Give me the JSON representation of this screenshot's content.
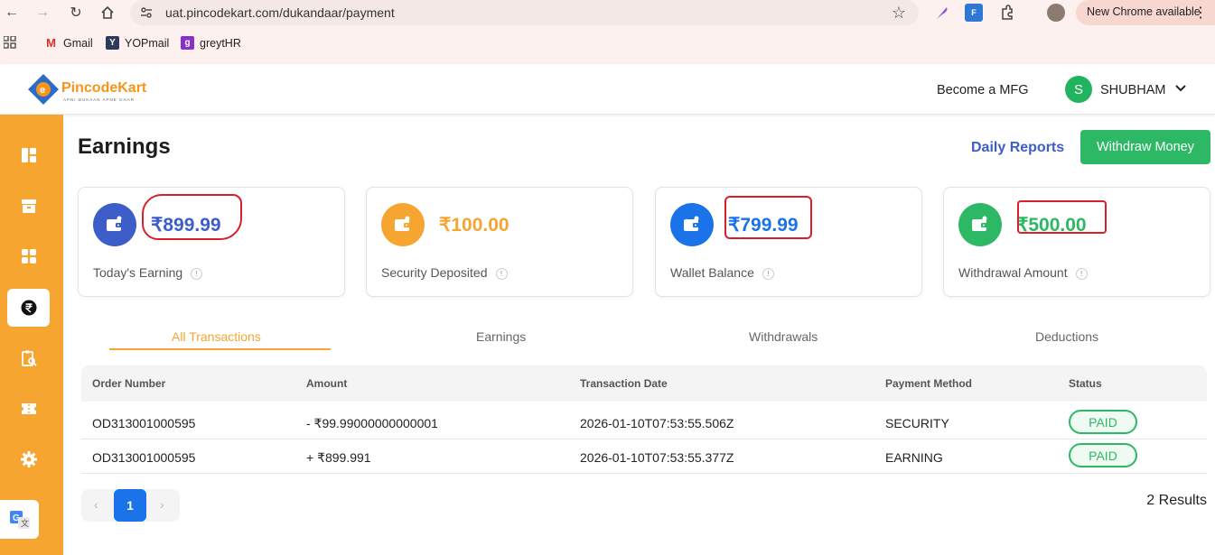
{
  "browser": {
    "url": "uat.pincodekart.com/dukandaar/payment",
    "new_chrome": "New Chrome available",
    "bookmarks": [
      {
        "label": "Gmail"
      },
      {
        "label": "YOPmail"
      },
      {
        "label": "greytHR"
      }
    ]
  },
  "header": {
    "logo_text": "PincodeKart",
    "logo_tagline": "APNI DUKAAN APNE GHAR",
    "become_mfg": "Become a MFG",
    "avatar_letter": "S",
    "user_name": "SHUBHAM"
  },
  "sidebar": {
    "items": [
      {
        "icon": "dashboard-icon"
      },
      {
        "icon": "store-icon"
      },
      {
        "icon": "grid-icon"
      },
      {
        "icon": "rupee-icon",
        "active": true
      },
      {
        "icon": "clipboard-search-icon"
      },
      {
        "icon": "ticket-icon"
      },
      {
        "icon": "gear-icon"
      }
    ]
  },
  "main": {
    "title": "Earnings",
    "daily_reports": "Daily Reports",
    "withdraw_money": "Withdraw Money",
    "cards": [
      {
        "value": "₹899.99",
        "label": "Today's Earning",
        "color": "#3d5dc9"
      },
      {
        "value": "₹100.00",
        "label": "Security Deposited",
        "color": "#f7a531"
      },
      {
        "value": "₹799.99",
        "label": "Wallet Balance",
        "color": "#1a73e8"
      },
      {
        "value": "₹500.00",
        "label": "Withdrawal Amount",
        "color": "#2cb864"
      }
    ],
    "info_mark": "!",
    "tabs": [
      "All Transactions",
      "Earnings",
      "Withdrawals",
      "Deductions"
    ],
    "active_tab": "All Transactions",
    "table": {
      "headers": [
        "Order Number",
        "Amount",
        "Transaction Date",
        "Payment Method",
        "Status"
      ],
      "rows": [
        {
          "order": "OD313001000595",
          "amount": "- ₹99.99000000000001",
          "date": "2026-01-10T07:53:55.506Z",
          "method": "SECURITY",
          "status": "PAID"
        },
        {
          "order": "OD313001000595",
          "amount": "+ ₹899.991",
          "date": "2026-01-10T07:53:55.377Z",
          "method": "EARNING",
          "status": "PAID"
        }
      ]
    },
    "pagination": {
      "prev": "‹",
      "current": "1",
      "next": "›"
    },
    "results": "2 Results"
  }
}
